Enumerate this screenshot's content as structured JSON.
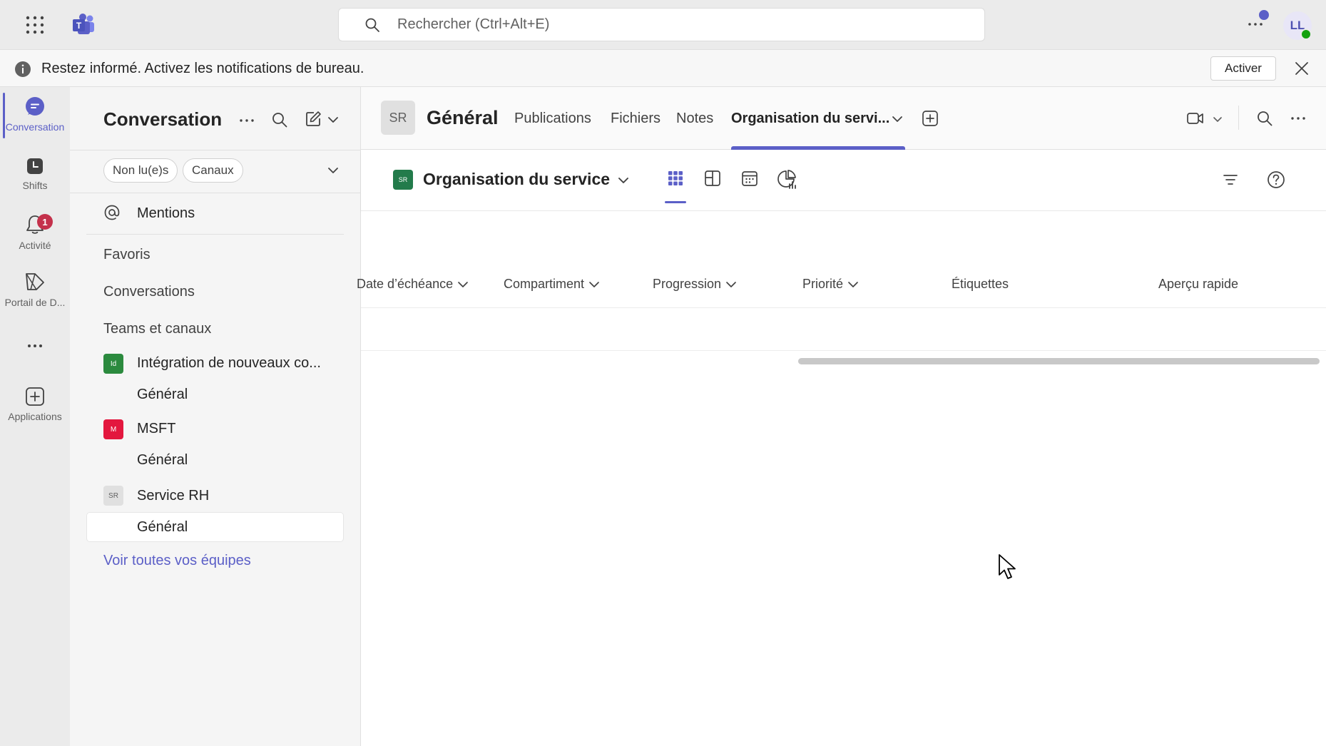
{
  "topbar": {
    "search_placeholder": "Rechercher (Ctrl+Alt+E)",
    "avatar_initials": "LL"
  },
  "notification": {
    "text": "Restez informé. Activez les notifications de bureau.",
    "button_label": "Activer"
  },
  "rail": {
    "items": [
      {
        "label": "Conversation",
        "icon": "chat-icon"
      },
      {
        "label": "Shifts",
        "icon": "shifts-icon"
      },
      {
        "label": "Activité",
        "icon": "bell-icon",
        "badge": "1"
      },
      {
        "label": "Portail de D...",
        "icon": "portal-icon"
      },
      {
        "label": "Applications",
        "icon": "add-app-icon"
      }
    ]
  },
  "panel": {
    "title": "Conversation",
    "filters": [
      "Non lu(e)s",
      "Canaux"
    ],
    "mentions": "Mentions",
    "sections": [
      "Favoris",
      "Conversations",
      "Teams et canaux"
    ],
    "teams": [
      {
        "initials": "Id",
        "name": "Intégration de nouveaux co...",
        "channel": "Général",
        "color": "#2b8a3e"
      },
      {
        "initials": "M",
        "name": "MSFT",
        "channel": "Général",
        "color": "#e3173e"
      },
      {
        "initials": "SR",
        "name": "Service RH",
        "channel": "Général",
        "color": "#e0e0e0"
      }
    ],
    "see_all": "Voir toutes vos équipes"
  },
  "channel": {
    "avatar": "SR",
    "title": "Général",
    "tabs": [
      "Publications",
      "Fichiers",
      "Notes",
      "Organisation du servi..."
    ]
  },
  "planner": {
    "avatar": "SR",
    "title": "Organisation du service",
    "columns": [
      "Date d’échéance",
      "Compartiment",
      "Progression",
      "Priorité",
      "Étiquettes",
      "Aperçu rapide"
    ]
  },
  "colors": {
    "accent": "#5b5fc7",
    "badge": "#c4314b",
    "presence": "#13a10e"
  }
}
